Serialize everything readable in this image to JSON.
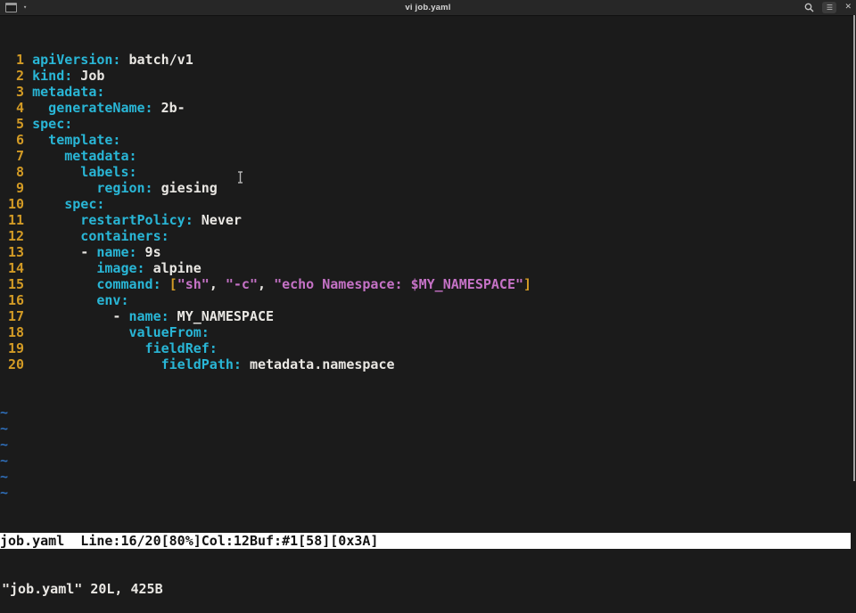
{
  "titlebar": {
    "title": "vi job.yaml"
  },
  "colors": {
    "key": "#29b6d6",
    "val": "#e9e7e3",
    "str": "#c572c6",
    "num": "#d39b25",
    "tilde": "#2f6eb8",
    "status_bg": "#ffffff",
    "status_fg": "#131313",
    "background": "#1b1b1b"
  },
  "terminal": {
    "lines": [
      {
        "num": 1,
        "seg": [
          {
            "t": "apiVersion:",
            "c": "key"
          },
          {
            "t": " batch/v1",
            "c": "val"
          }
        ]
      },
      {
        "num": 2,
        "seg": [
          {
            "t": "kind:",
            "c": "key"
          },
          {
            "t": " Job",
            "c": "val"
          }
        ]
      },
      {
        "num": 3,
        "seg": [
          {
            "t": "metadata:",
            "c": "key"
          }
        ]
      },
      {
        "num": 4,
        "seg": [
          {
            "t": "  generateName:",
            "c": "key"
          },
          {
            "t": " 2b-",
            "c": "val"
          }
        ]
      },
      {
        "num": 5,
        "seg": [
          {
            "t": "spec:",
            "c": "key"
          }
        ]
      },
      {
        "num": 6,
        "seg": [
          {
            "t": "  template:",
            "c": "key"
          }
        ]
      },
      {
        "num": 7,
        "seg": [
          {
            "t": "    metadata:",
            "c": "key"
          }
        ]
      },
      {
        "num": 8,
        "seg": [
          {
            "t": "      labels:",
            "c": "key"
          }
        ]
      },
      {
        "num": 9,
        "seg": [
          {
            "t": "        region:",
            "c": "key"
          },
          {
            "t": " giesing",
            "c": "val"
          }
        ]
      },
      {
        "num": 10,
        "seg": [
          {
            "t": "    spec:",
            "c": "key"
          }
        ]
      },
      {
        "num": 11,
        "seg": [
          {
            "t": "      restartPolicy:",
            "c": "key"
          },
          {
            "t": " Never",
            "c": "val"
          }
        ]
      },
      {
        "num": 12,
        "seg": [
          {
            "t": "      containers:",
            "c": "key"
          }
        ]
      },
      {
        "num": 13,
        "seg": [
          {
            "t": "      - ",
            "c": "val"
          },
          {
            "t": "name:",
            "c": "key"
          },
          {
            "t": " 9s",
            "c": "val"
          }
        ]
      },
      {
        "num": 14,
        "seg": [
          {
            "t": "        image:",
            "c": "key"
          },
          {
            "t": " alpine",
            "c": "val"
          }
        ]
      },
      {
        "num": 15,
        "seg": [
          {
            "t": "        command:",
            "c": "key"
          },
          {
            "t": " ",
            "c": "val"
          },
          {
            "t": "[",
            "c": "br"
          },
          {
            "t": "\"sh\"",
            "c": "str"
          },
          {
            "t": ", ",
            "c": "val"
          },
          {
            "t": "\"-c\"",
            "c": "str"
          },
          {
            "t": ", ",
            "c": "val"
          },
          {
            "t": "\"echo Namespace: $MY_NAMESPACE\"",
            "c": "str"
          },
          {
            "t": "]",
            "c": "br"
          }
        ]
      },
      {
        "num": 16,
        "seg": [
          {
            "t": "        env:",
            "c": "key"
          }
        ]
      },
      {
        "num": 17,
        "seg": [
          {
            "t": "          - ",
            "c": "val"
          },
          {
            "t": "name:",
            "c": "key"
          },
          {
            "t": " MY_NAMESPACE",
            "c": "val"
          }
        ]
      },
      {
        "num": 18,
        "seg": [
          {
            "t": "            valueFrom:",
            "c": "key"
          }
        ]
      },
      {
        "num": 19,
        "seg": [
          {
            "t": "              fieldRef:",
            "c": "key"
          }
        ]
      },
      {
        "num": 20,
        "seg": [
          {
            "t": "                fieldPath:",
            "c": "key"
          },
          {
            "t": " metadata.namespace",
            "c": "val"
          }
        ]
      }
    ],
    "tilde": "~",
    "tilde_count": 6,
    "status_text": "job.yaml  Line:16/20[80%]Col:12Buf:#1[58][0x3A]",
    "cmdline_text": "\"job.yaml\" 20L, 425B"
  },
  "icons": {
    "left": [
      "terminal-icon",
      "chevron-down-icon"
    ],
    "right": [
      "search-icon",
      "menu-icon",
      "close-icon"
    ],
    "menu_glyph": "☰",
    "close_glyph": "✕",
    "chevron_glyph": "▾"
  }
}
